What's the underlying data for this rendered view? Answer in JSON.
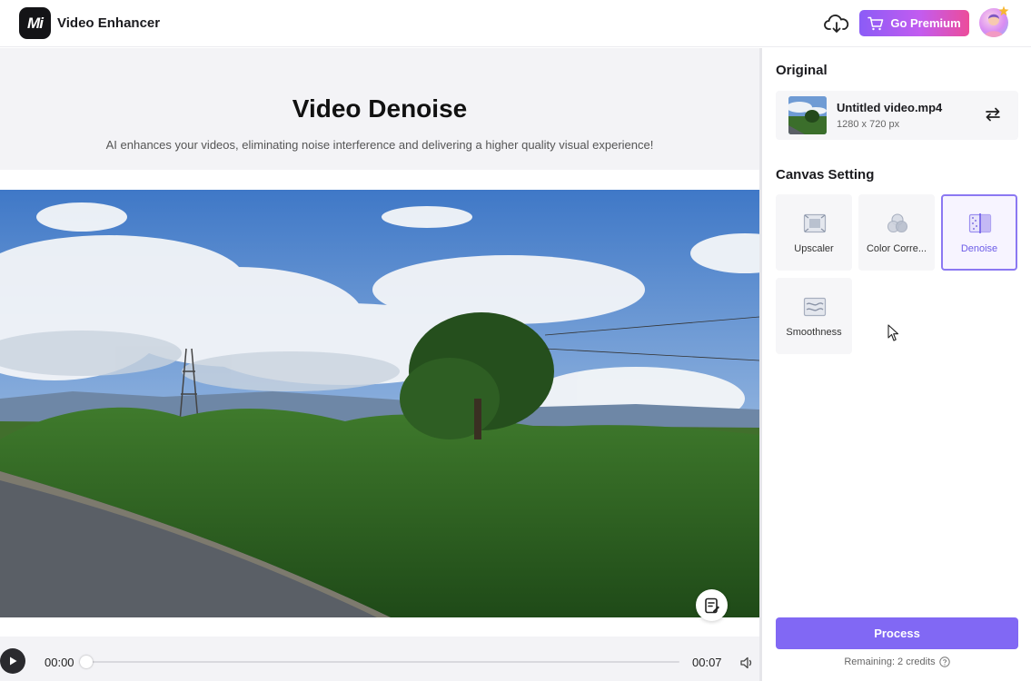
{
  "header": {
    "logo_text": "Mi",
    "app_title": "Video Enhancer",
    "premium_label": "Go Premium",
    "icons": {
      "cloud": "cloud-download-icon",
      "cart": "cart-icon",
      "avatar": "avatar"
    }
  },
  "main": {
    "title": "Video Denoise",
    "subtitle": "AI enhances your videos, eliminating noise interference and delivering a higher quality visual experience!",
    "player": {
      "current_time": "00:00",
      "duration": "00:07",
      "progress": 0
    }
  },
  "panel": {
    "original_heading": "Original",
    "file": {
      "name": "Untitled video.mp4",
      "resolution": "1280 x 720 px"
    },
    "canvas_heading": "Canvas Setting",
    "tools": [
      {
        "label": "Upscaler",
        "icon": "upscaler-icon",
        "active": false
      },
      {
        "label": "Color Corre...",
        "icon": "color-correction-icon",
        "active": false
      },
      {
        "label": "Denoise",
        "icon": "denoise-icon",
        "active": true
      },
      {
        "label": "Smoothness",
        "icon": "smoothness-icon",
        "active": false
      }
    ],
    "process_label": "Process",
    "credits_text": "Remaining: 2 credits"
  },
  "colors": {
    "accent": "#8168f4",
    "premium_gradient_start": "#8b5cf6",
    "premium_gradient_end": "#ec4c9a",
    "active_border": "#8b78f2"
  }
}
